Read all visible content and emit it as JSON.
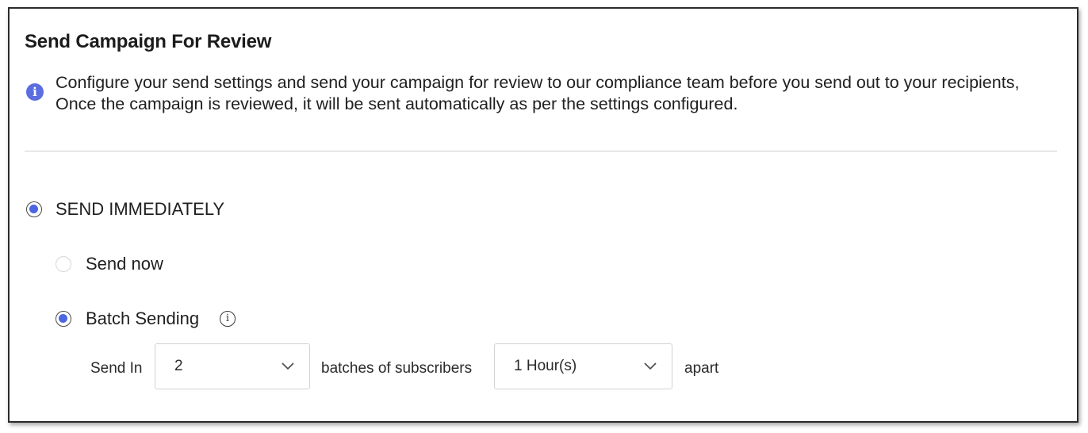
{
  "dialog": {
    "title": "Send Campaign For Review",
    "info_text": "Configure your send settings and send your campaign for review to our compliance team before you send out to your recipients, Once the campaign is reviewed, it will be sent automatically as per the settings configured."
  },
  "options": {
    "send_immediately": {
      "label": "SEND IMMEDIATELY",
      "selected": true
    },
    "send_now": {
      "label": "Send now",
      "selected": false
    },
    "batch_sending": {
      "label": "Batch Sending",
      "selected": true
    }
  },
  "batch": {
    "send_in_label": "Send In",
    "batches_value": "2",
    "batches_of_label": "batches of subscribers",
    "interval_value": "1 Hour(s)",
    "apart_label": "apart"
  },
  "colors": {
    "accent": "#4e65e2",
    "info_icon": "#5a6ee0"
  },
  "icons": {
    "info": "info-circle-icon",
    "chevron": "chevron-down-icon"
  }
}
